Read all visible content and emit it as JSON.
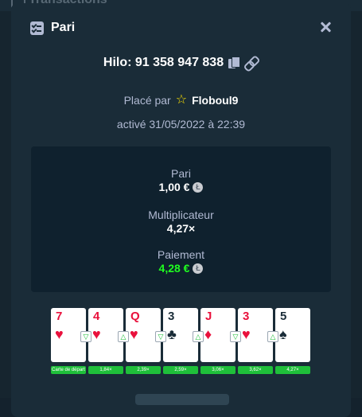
{
  "background": {
    "title": "Transactions"
  },
  "modal": {
    "title": "Pari",
    "bet_id": "Hilo: 91 358 947 838",
    "placed_by_prefix": "Placé par",
    "placed_by_user": "Floboul9",
    "activated": "activé 31/05/2022 à 22:39"
  },
  "stats": {
    "bet_label": "Pari",
    "bet_value": "1,00 €",
    "multiplier_label": "Multiplicateur",
    "multiplier_value": "4,27×",
    "payout_label": "Paiement",
    "payout_value": "4,28 €",
    "coin_symbol": "Ł"
  },
  "cards": [
    {
      "rank": "7",
      "suit": "♥",
      "color": "red",
      "label": "Carte de départ"
    },
    {
      "rank": "4",
      "suit": "♥",
      "color": "red",
      "guess": "▽",
      "label": "1,84×"
    },
    {
      "rank": "Q",
      "suit": "♥",
      "color": "red",
      "guess": "△",
      "label": "2,39×"
    },
    {
      "rank": "3",
      "suit": "♣",
      "color": "black",
      "guess": "▽",
      "label": "2,59×"
    },
    {
      "rank": "J",
      "suit": "♦",
      "color": "red",
      "guess": "△",
      "label": "3,06×"
    },
    {
      "rank": "3",
      "suit": "♥",
      "color": "red",
      "guess": "▽",
      "label": "3,62×"
    },
    {
      "rank": "5",
      "suit": "♠",
      "color": "black",
      "guess": "△",
      "label": "4,27×"
    }
  ],
  "colors": {
    "accent_green": "#1fff20",
    "card_red": "#e9113c",
    "panel": "#1a2c38",
    "inner": "#0f212e"
  }
}
